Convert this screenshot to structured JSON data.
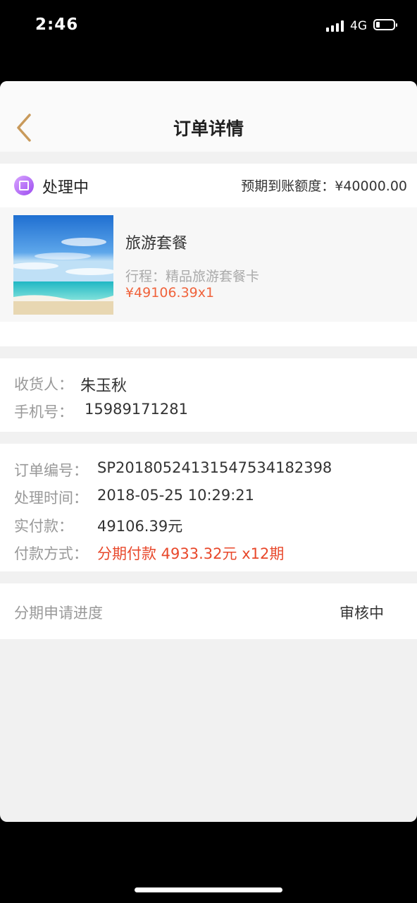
{
  "status_bar": {
    "time": "2:46",
    "network": "4G"
  },
  "nav": {
    "title": "订单详情"
  },
  "order_status": {
    "label": "处理中",
    "expected_label": "预期到账额度：",
    "expected_amount": "¥40000.00"
  },
  "product": {
    "name": "旅游套餐",
    "route": "行程：精品旅游套餐卡",
    "price": "¥49106.39x1"
  },
  "consignee": {
    "name_label": "收货人：",
    "name": "朱玉秋",
    "phone_label": "手机号：",
    "phone": "15989171281"
  },
  "order_info": {
    "number_label": "订单编号：",
    "number": "SP2018052413154753418239​8",
    "time_label": "处理时间：",
    "time": "2018-05-25 10:29:21",
    "paid_label": "实付款：",
    "paid": "49106.39元",
    "method_label": "付款方式：",
    "method": "分期付款 4933.32元 x12期"
  },
  "installment": {
    "label": "分期申请进度",
    "status": "审核中"
  },
  "colors": {
    "accent": "#e8482b",
    "price": "#f0633c",
    "back_arrow": "#c99a5b",
    "status_icon": "#9c4cf0"
  }
}
